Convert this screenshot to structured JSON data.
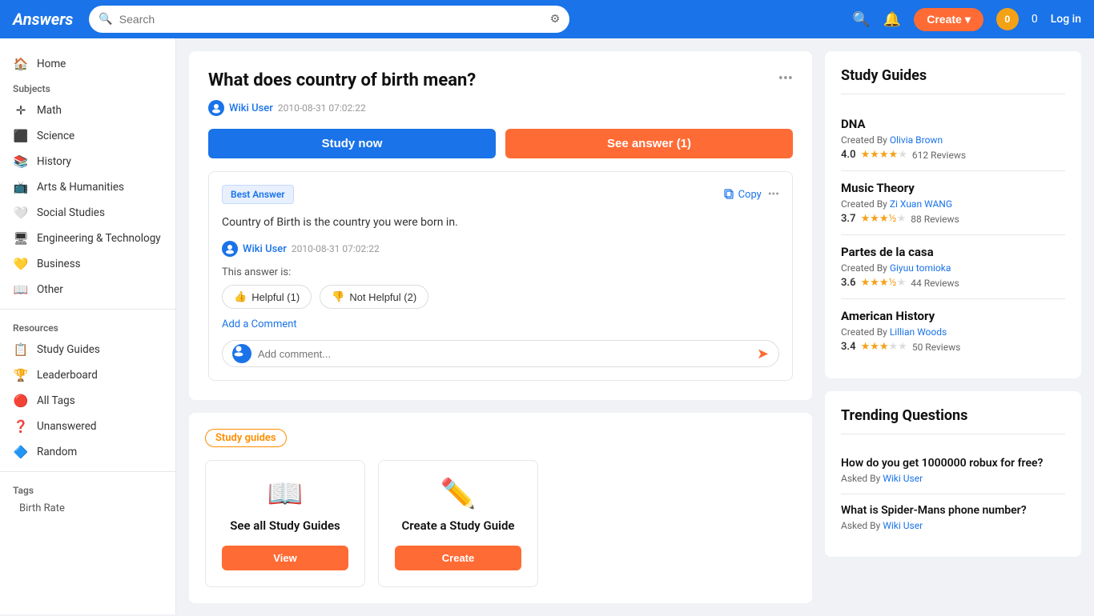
{
  "header": {
    "logo": "Answers",
    "search_placeholder": "Search",
    "create_label": "Create",
    "points": "0",
    "login_label": "Log in"
  },
  "sidebar": {
    "subjects_label": "Subjects",
    "items": [
      {
        "id": "home",
        "icon": "🏠",
        "label": "Home"
      },
      {
        "id": "math",
        "icon": "✛",
        "label": "Math"
      },
      {
        "id": "science",
        "icon": "⬜",
        "label": "Science"
      },
      {
        "id": "history",
        "icon": "📚",
        "label": "History"
      },
      {
        "id": "arts-humanities",
        "icon": "📺",
        "label": "Arts & Humanities"
      },
      {
        "id": "social-studies",
        "icon": "❤",
        "label": "Social Studies"
      },
      {
        "id": "engineering-technology",
        "icon": "🖥",
        "label": "Engineering & Technology"
      },
      {
        "id": "business",
        "icon": "💛",
        "label": "Business"
      },
      {
        "id": "other",
        "icon": "📖",
        "label": "Other"
      }
    ],
    "resources_label": "Resources",
    "resources": [
      {
        "id": "study-guides",
        "icon": "📋",
        "label": "Study Guides"
      },
      {
        "id": "leaderboard",
        "icon": "🏆",
        "label": "Leaderboard"
      },
      {
        "id": "all-tags",
        "icon": "🔴",
        "label": "All Tags"
      },
      {
        "id": "unanswered",
        "icon": "❓",
        "label": "Unanswered"
      },
      {
        "id": "random",
        "icon": "🔷",
        "label": "Random"
      }
    ],
    "tags_label": "Tags",
    "tags": [
      {
        "id": "birth-rate",
        "label": "Birth Rate"
      }
    ]
  },
  "question": {
    "title": "What does country of birth mean?",
    "user": "Wiki User",
    "date": "2010-08-31 07:02:22",
    "study_now_label": "Study now",
    "see_answer_label": "See answer (1)",
    "best_answer_label": "Best Answer",
    "copy_label": "Copy",
    "answer_text": "Country of Birth is the country you were born in.",
    "answer_user": "Wiki User",
    "answer_date": "2010-08-31 07:02:22",
    "this_answer_is": "This answer is:",
    "helpful_label": "Helpful (1)",
    "not_helpful_label": "Not Helpful (2)",
    "add_comment_label": "Add a Comment",
    "comment_placeholder": "Add comment..."
  },
  "study_guides_section": {
    "tag_label": "Study guides",
    "see_all_title": "See all Study Guides",
    "create_title": "Create a Study Guide",
    "view_label": "View",
    "create_btn_label": "Create"
  },
  "right_sidebar": {
    "study_guides_title": "Study Guides",
    "guides": [
      {
        "name": "DNA",
        "creator": "Olivia Brown",
        "rating": "4.0",
        "stars": 4.0,
        "reviews": "612 Reviews"
      },
      {
        "name": "Music Theory",
        "creator": "Zi Xuan WANG",
        "rating": "3.7",
        "stars": 3.7,
        "reviews": "88 Reviews"
      },
      {
        "name": "Partes de la casa",
        "creator": "Giyuu tomioka",
        "rating": "3.6",
        "stars": 3.6,
        "reviews": "44 Reviews"
      },
      {
        "name": "American History",
        "creator": "Lillian Woods",
        "rating": "3.4",
        "stars": 3.4,
        "reviews": "50 Reviews"
      }
    ],
    "trending_title": "Trending Questions",
    "trending": [
      {
        "question": "How do you get 1000000 robux for free?",
        "asked_by": "Wiki User"
      },
      {
        "question": "What is Spider-Mans phone number?",
        "asked_by": "Wiki User"
      }
    ]
  }
}
